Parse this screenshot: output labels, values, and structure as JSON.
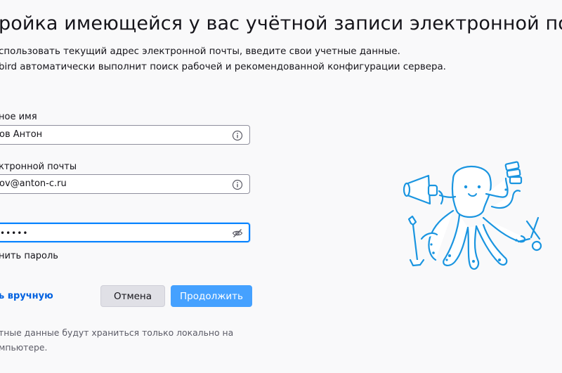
{
  "header": {
    "title": "ройка имеющейся у вас учётной записи электронной поч"
  },
  "intro": {
    "line1": "спользовать текущий адрес электронной почты, введите свои учетные данные.",
    "line2": "bird автоматически выполнит поиск рабочей и рекомендованной конфигурации сервера."
  },
  "form": {
    "name_label": "ное имя",
    "name_value": "ов Антон",
    "email_label": "ктронной почты",
    "email_value": "ov@anton-c.ru",
    "password_label": "",
    "password_value": "•••••",
    "remember_label": "нить пароль"
  },
  "actions": {
    "manual_link": "ь вручную",
    "cancel": "Отмена",
    "continue": "Продолжить"
  },
  "footnote": {
    "line1": "тные данные будут храниться только локально на",
    "line2": "мпьютере."
  },
  "icons": {
    "info": "info-icon",
    "eye": "eye-slash-icon",
    "mascot": "octopus-mascot"
  },
  "colors": {
    "accent": "#45a1ff",
    "link": "#0061e0",
    "focus": "#0a84ff",
    "mascot": "#1a95e0"
  }
}
